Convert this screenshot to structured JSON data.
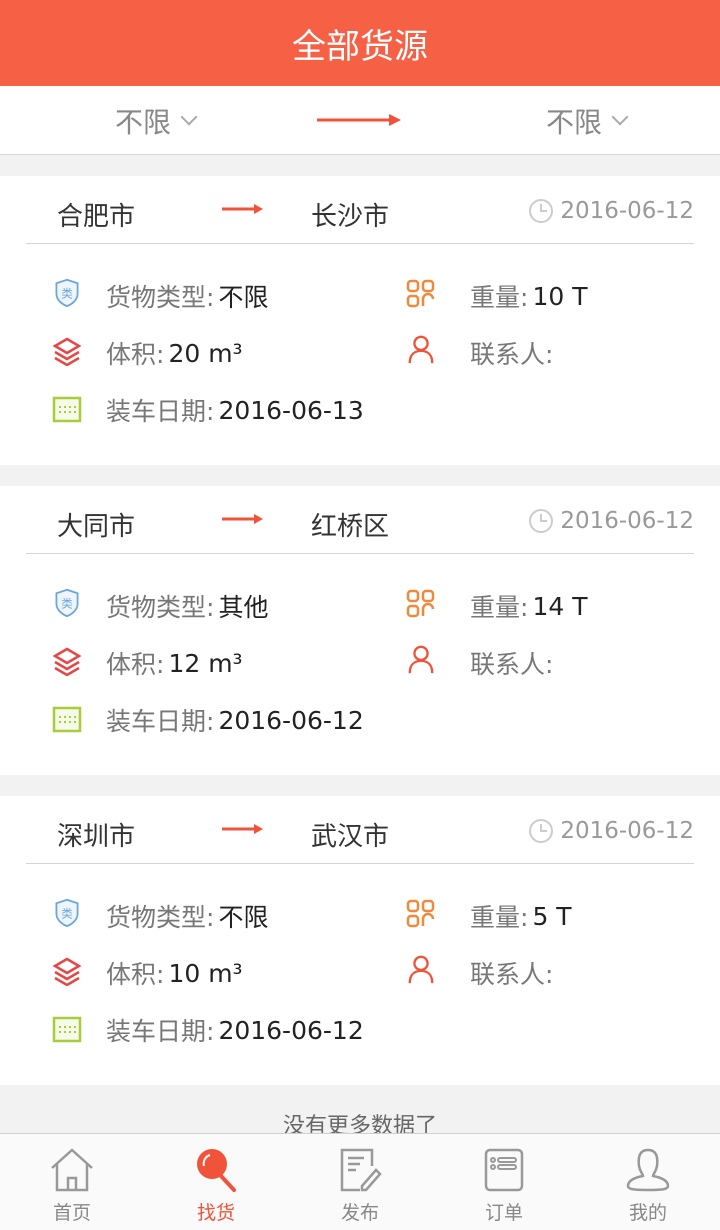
{
  "header": {
    "title": "全部货源"
  },
  "filter": {
    "from": "不限",
    "to": "不限"
  },
  "labels": {
    "type": "货物类型:",
    "weight": "重量:",
    "volume": "体积:",
    "contact": "联系人:",
    "load_date": "装车日期:"
  },
  "cards": [
    {
      "from": "合肥市",
      "to": "长沙市",
      "date": "2016-06-12",
      "type": "不限",
      "weight": "10 T",
      "volume": "20 m³",
      "contact": "",
      "load_date": "2016-06-13"
    },
    {
      "from": "大同市",
      "to": "红桥区",
      "date": "2016-06-12",
      "type": "其他",
      "weight": "14 T",
      "volume": "12 m³",
      "contact": "",
      "load_date": "2016-06-12"
    },
    {
      "from": "深圳市",
      "to": "武汉市",
      "date": "2016-06-12",
      "type": "不限",
      "weight": "5 T",
      "volume": "10 m³",
      "contact": "",
      "load_date": "2016-06-12"
    }
  ],
  "footer": {
    "no_more": "没有更多数据了"
  },
  "nav": [
    {
      "label": "首页",
      "icon": "home-icon"
    },
    {
      "label": "找货",
      "icon": "search-icon",
      "active": true
    },
    {
      "label": "发布",
      "icon": "publish-icon"
    },
    {
      "label": "订单",
      "icon": "order-icon"
    },
    {
      "label": "我的",
      "icon": "user-icon"
    }
  ],
  "colors": {
    "accent": "#f66044",
    "arrow": "#f0533a"
  }
}
